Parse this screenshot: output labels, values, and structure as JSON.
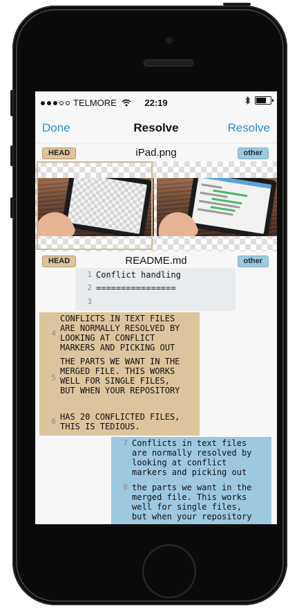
{
  "status": {
    "carrier": "TELMORE",
    "time": "22:19"
  },
  "nav": {
    "left": "Done",
    "title": "Resolve",
    "right": "Resolve"
  },
  "files": [
    {
      "name": "iPad.png",
      "head_tag": "HEAD",
      "other_tag": "other"
    },
    {
      "name": "README.md",
      "head_tag": "HEAD",
      "other_tag": "other"
    }
  ],
  "code": {
    "neutral": [
      {
        "num": "1",
        "text": "Conflict handling"
      },
      {
        "num": "2",
        "text": "================"
      },
      {
        "num": "3",
        "text": ""
      }
    ],
    "head": [
      {
        "num": "4",
        "text": "CONFLICTS IN TEXT FILES\nARE NORMALLY RESOLVED BY\nLOOKING AT CONFLICT\nMARKERS AND PICKING OUT"
      },
      {
        "num": "5",
        "text": "THE PARTS WE WANT IN THE\nMERGED FILE. THIS WORKS\nWELL FOR SINGLE FILES,\nBUT WHEN YOUR REPOSITORY"
      },
      {
        "num": "6",
        "text": "HAS 20 CONFLICTED FILES,\nTHIS IS TEDIOUS."
      }
    ],
    "other": [
      {
        "num": "7",
        "text": "Conflicts in text files\nare normally resolved by\nlooking at conflict\nmarkers and picking out"
      },
      {
        "num": "8",
        "text": "the parts we want in the\nmerged file. This works\nwell for single files,\nbut when your repository"
      }
    ]
  }
}
